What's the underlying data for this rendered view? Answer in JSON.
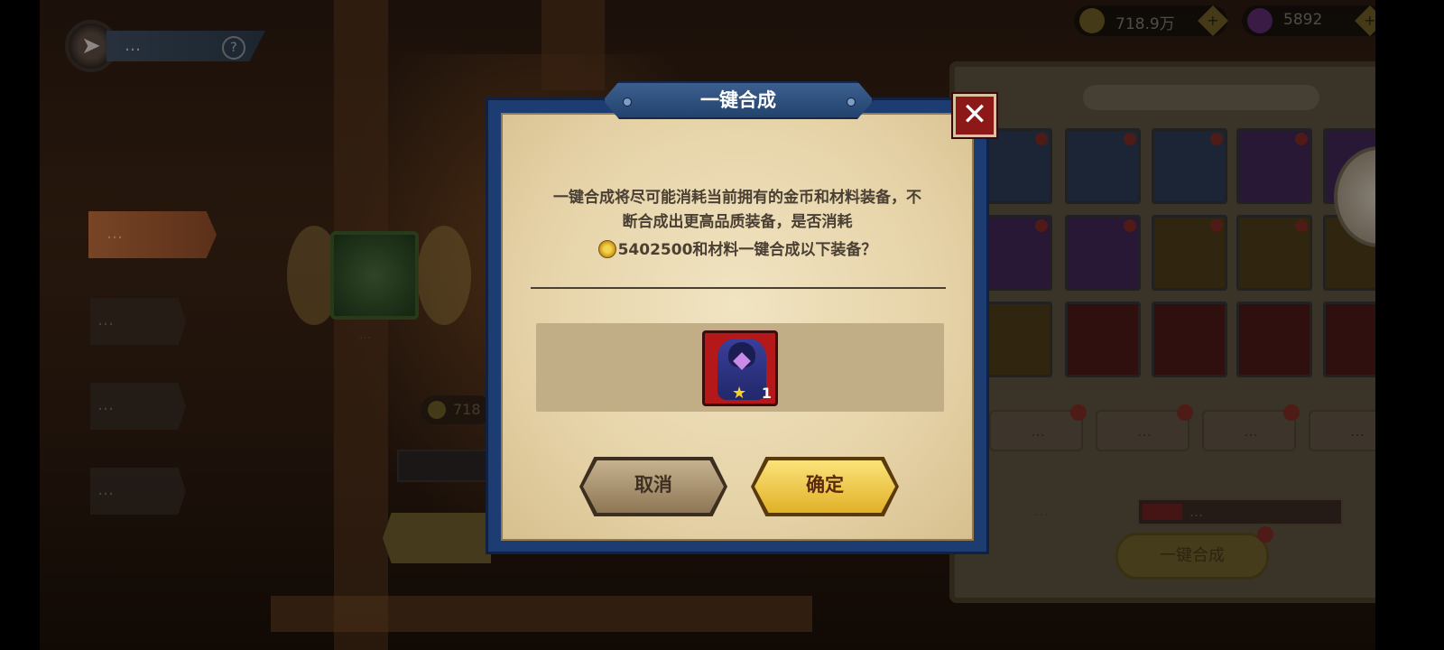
{
  "background": {
    "screen_title": "…",
    "side_tabs": [
      {
        "label": "…"
      },
      {
        "label": "…"
      },
      {
        "label": "…"
      },
      {
        "label": "…"
      }
    ],
    "coin_partial": "718",
    "center_item_level": "…",
    "resources": {
      "gold": "718.9万",
      "diamonds": "5892"
    },
    "right_panel": {
      "category_buttons": [
        {
          "label": "…"
        },
        {
          "label": "…"
        },
        {
          "label": "…"
        },
        {
          "label": "…"
        }
      ],
      "quality_label": "…",
      "quality_select": "…",
      "one_click_button": "一键合成"
    }
  },
  "dialog": {
    "title": "一键合成",
    "description_line1": "一键合成将尽可能消耗当前拥有的金币和材料装备，不",
    "description_line2": "断合成出更高品质装备，是否消耗",
    "cost_amount": "5402500",
    "cost_suffix": "和材料一键合成以下装备？",
    "result_item": {
      "icon": "blue-cloak-armor-icon",
      "stars": 1,
      "count": "1"
    },
    "cancel_label": "取消",
    "confirm_label": "确定",
    "close_icon": "close-x-icon"
  },
  "colors": {
    "dialog_frame": "#1d3c72",
    "parchment": "#e6d3a8",
    "confirm_button": "#f2c84a",
    "cancel_button": "#a8936f",
    "close_button": "#8c1818",
    "item_frame_red": "#b41818"
  }
}
